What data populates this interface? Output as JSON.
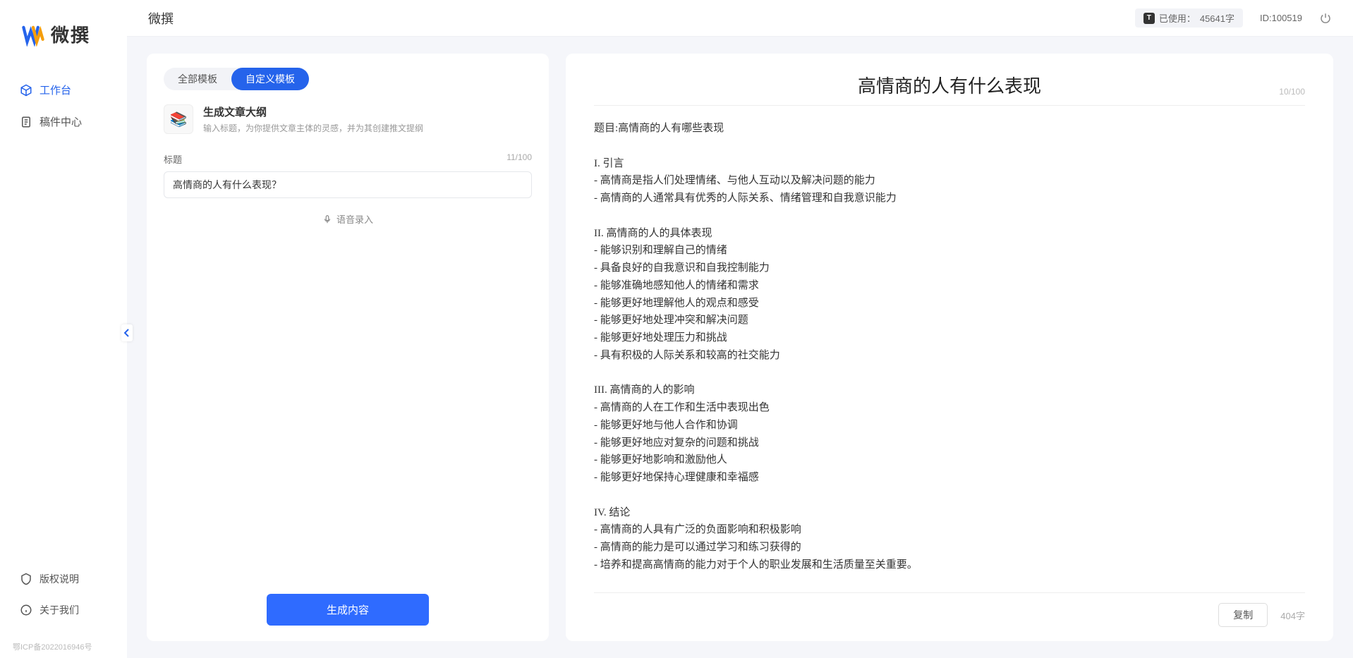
{
  "app": {
    "logo_text": "微撰",
    "header_title": "微撰"
  },
  "nav": {
    "workspace": "工作台",
    "drafts": "稿件中心",
    "copyright": "版权说明",
    "about": "关于我们",
    "icp": "鄂ICP备2022016946号"
  },
  "topbar": {
    "usage_label": "已使用：",
    "usage_value": "45641字",
    "id_label": "ID:100519"
  },
  "tabs": {
    "all": "全部模板",
    "custom": "自定义模板"
  },
  "template": {
    "name": "生成文章大纲",
    "desc": "输入标题，为你提供文章主体的灵感，并为其创建推文提纲"
  },
  "field": {
    "label": "标题",
    "count": "11/100",
    "value": "高情商的人有什么表现？",
    "voice": "语音录入"
  },
  "generate_label": "生成内容",
  "output": {
    "title": "高情商的人有什么表现",
    "counter": "10/100",
    "body": "题目:高情商的人有哪些表现\n\nI. 引言\n- 高情商是指人们处理情绪、与他人互动以及解决问题的能力\n- 高情商的人通常具有优秀的人际关系、情绪管理和自我意识能力\n\nII. 高情商的人的具体表现\n- 能够识别和理解自己的情绪\n- 具备良好的自我意识和自我控制能力\n- 能够准确地感知他人的情绪和需求\n- 能够更好地理解他人的观点和感受\n- 能够更好地处理冲突和解决问题\n- 能够更好地处理压力和挑战\n- 具有积极的人际关系和较高的社交能力\n\nIII. 高情商的人的影响\n- 高情商的人在工作和生活中表现出色\n- 能够更好地与他人合作和协调\n- 能够更好地应对复杂的问题和挑战\n- 能够更好地影响和激励他人\n- 能够更好地保持心理健康和幸福感\n\nIV. 结论\n- 高情商的人具有广泛的负面影响和积极影响\n- 高情商的能力是可以通过学习和练习获得的\n- 培养和提高高情商的能力对于个人的职业发展和生活质量至关重要。",
    "copy": "复制",
    "wordcount": "404字"
  }
}
